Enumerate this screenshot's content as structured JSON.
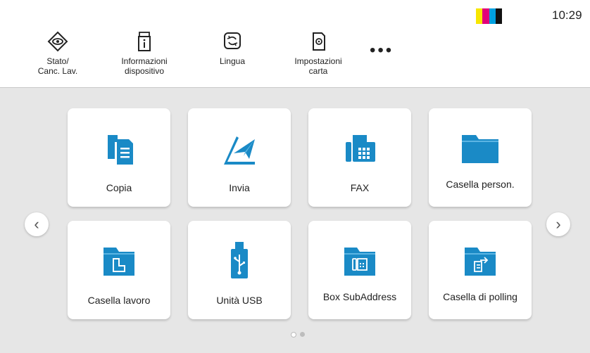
{
  "status": {
    "time": "10:29",
    "toner_colors": [
      "#f7e600",
      "#e2007a",
      "#00a0e0",
      "#111111"
    ]
  },
  "header": {
    "buttons": [
      {
        "label": "Stato/\nCanc. Lav.",
        "icon": "eye-diamond-icon"
      },
      {
        "label": "Informazioni\ndispositivo",
        "icon": "device-info-icon"
      },
      {
        "label": "Lingua",
        "icon": "language-icon"
      },
      {
        "label": "Impostazioni\ncarta",
        "icon": "paper-settings-icon"
      }
    ],
    "more_label": "•••"
  },
  "tiles": [
    {
      "label": "Copia",
      "icon": "copy-icon"
    },
    {
      "label": "Invia",
      "icon": "send-icon"
    },
    {
      "label": "FAX",
      "icon": "fax-icon"
    },
    {
      "label": "Casella person.",
      "icon": "folder-icon"
    },
    {
      "label": "Casella lavoro",
      "icon": "job-box-icon"
    },
    {
      "label": "Unità USB",
      "icon": "usb-drive-icon"
    },
    {
      "label": "Box SubAddress",
      "icon": "subaddress-box-icon"
    },
    {
      "label": "Casella di polling",
      "icon": "polling-box-icon"
    }
  ],
  "nav": {
    "prev": "‹",
    "next": "›"
  },
  "colors": {
    "accent": "#1a8ac6",
    "background": "#e6e6e6"
  },
  "pager": {
    "current": 1,
    "total": 2
  }
}
